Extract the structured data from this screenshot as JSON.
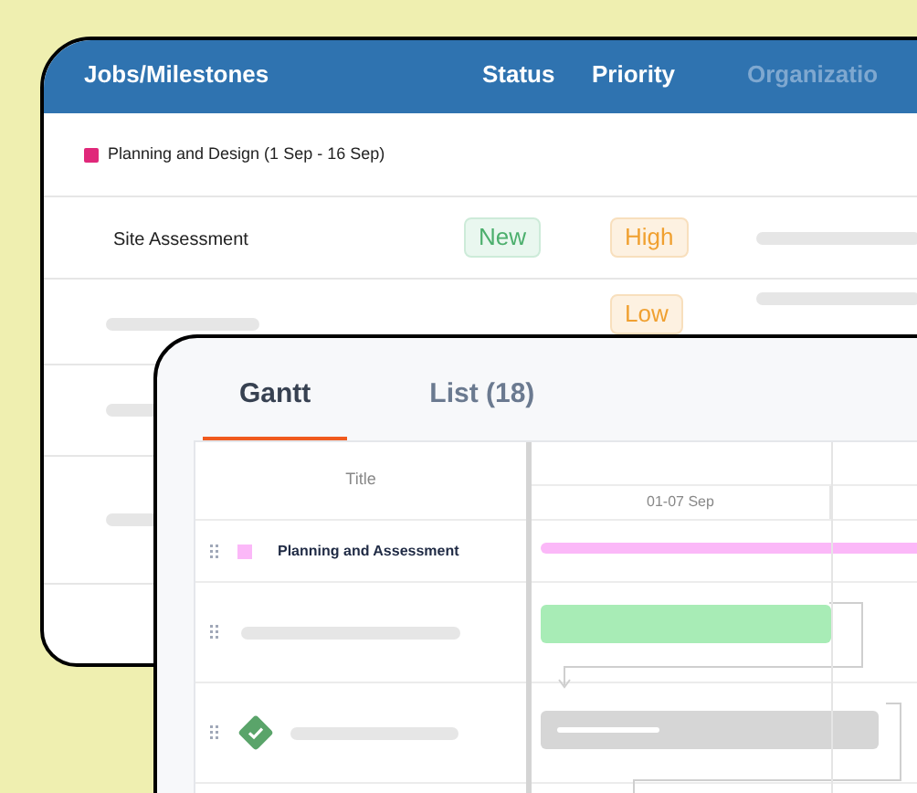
{
  "jobs_table": {
    "columns": [
      "Jobs/Milestones",
      "Status",
      "Priority",
      "Organizatio"
    ],
    "rows": [
      {
        "kind": "group",
        "title": "Planning and Design (1 Sep - 16 Sep)",
        "color": "#e0287a"
      },
      {
        "kind": "job",
        "title": "Site Assessment",
        "status": "New",
        "priority": "High"
      },
      {
        "kind": "job",
        "status": "",
        "priority": "Low"
      },
      {
        "kind": "job"
      },
      {
        "kind": "job"
      }
    ]
  },
  "tabs": [
    {
      "label": "Gantt",
      "selected": true
    },
    {
      "label": "List (18)",
      "selected": false
    }
  ],
  "gantt": {
    "title_header": "Title",
    "date_header": "01-07 Sep",
    "rows": [
      {
        "kind": "group",
        "title": "Planning and Assessment",
        "color": "#fbb8f8"
      },
      {
        "kind": "task",
        "color": "#a8ecb6"
      },
      {
        "kind": "milestone",
        "color": "#d6d6d6"
      }
    ]
  }
}
